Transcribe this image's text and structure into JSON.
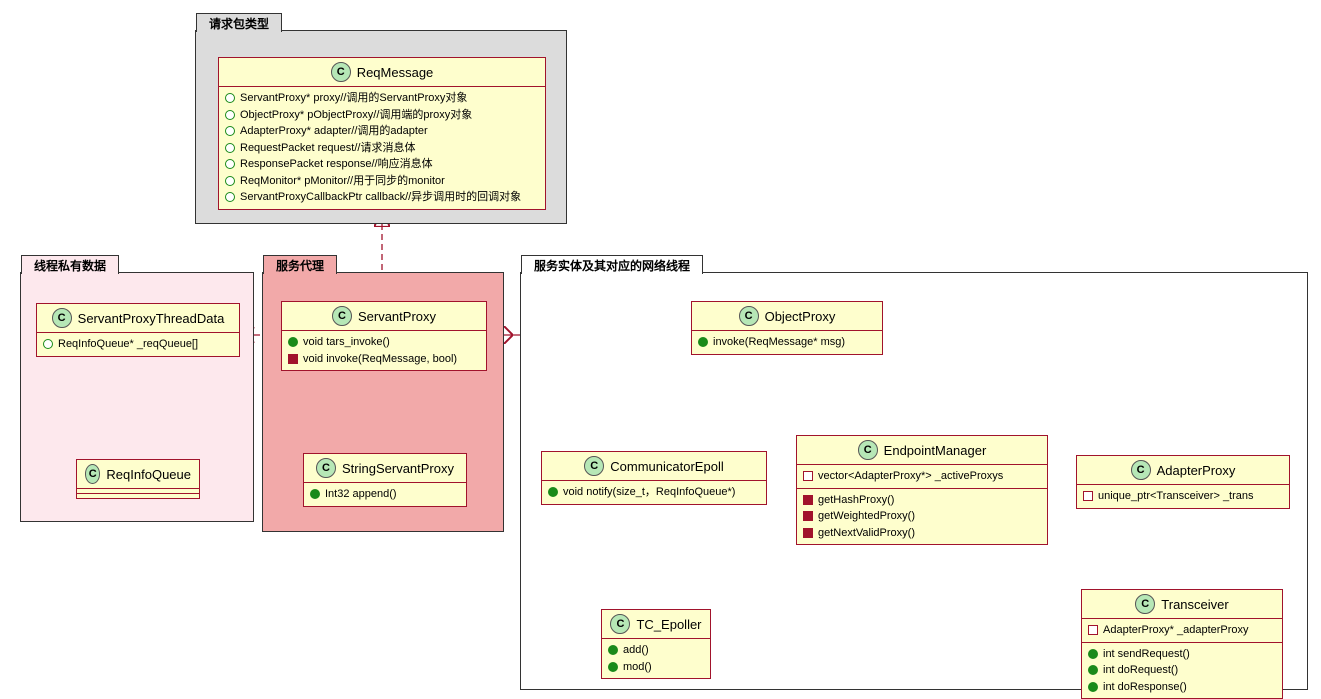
{
  "packages": {
    "reqType": "请求包类型",
    "threadData": "线程私有数据",
    "proxy": "服务代理",
    "entity": "服务实体及其对应的网络线程"
  },
  "classes": {
    "ReqMessage": {
      "name": "ReqMessage",
      "attrs": [
        "ServantProxy* proxy//调用的ServantProxy对象",
        "ObjectProxy* pObjectProxy//调用端的proxy对象",
        "AdapterProxy* adapter//调用的adapter",
        "RequestPacket request//请求消息体",
        "ResponsePacket response//响应消息体",
        "ReqMonitor* pMonitor//用于同步的monitor",
        "ServantProxyCallbackPtr callback//异步调用时的回调对象"
      ]
    },
    "ServantProxyThreadData": {
      "name": "ServantProxyThreadData",
      "attrs": [
        "ReqInfoQueue* _reqQueue[]"
      ]
    },
    "ReqInfoQueue": {
      "name": "ReqInfoQueue"
    },
    "ServantProxy": {
      "name": "ServantProxy",
      "ops": [
        "void tars_invoke()",
        "void invoke(ReqMessage, bool)"
      ]
    },
    "StringServantProxy": {
      "name": "StringServantProxy",
      "ops": [
        "Int32 append()"
      ]
    },
    "ObjectProxy": {
      "name": "ObjectProxy",
      "ops": [
        "invoke(ReqMessage* msg)"
      ]
    },
    "CommunicatorEpoll": {
      "name": "CommunicatorEpoll",
      "ops": [
        "void notify(size_t，ReqInfoQueue*)"
      ]
    },
    "EndpointManager": {
      "name": "EndpointManager",
      "attrs": [
        "vector<AdapterProxy*> _activeProxys"
      ],
      "ops": [
        "getHashProxy()",
        "getWeightedProxy()",
        "getNextValidProxy()"
      ]
    },
    "AdapterProxy": {
      "name": "AdapterProxy",
      "attrs": [
        "unique_ptr<Transceiver> _trans"
      ]
    },
    "Transceiver": {
      "name": "Transceiver",
      "attrs": [
        "AdapterProxy* _adapterProxy"
      ],
      "ops": [
        "int sendRequest()",
        "int doRequest()",
        "int doResponse()"
      ]
    },
    "TC_Epoller": {
      "name": "TC_Epoller",
      "ops": [
        "add()",
        "mod()"
      ]
    }
  }
}
